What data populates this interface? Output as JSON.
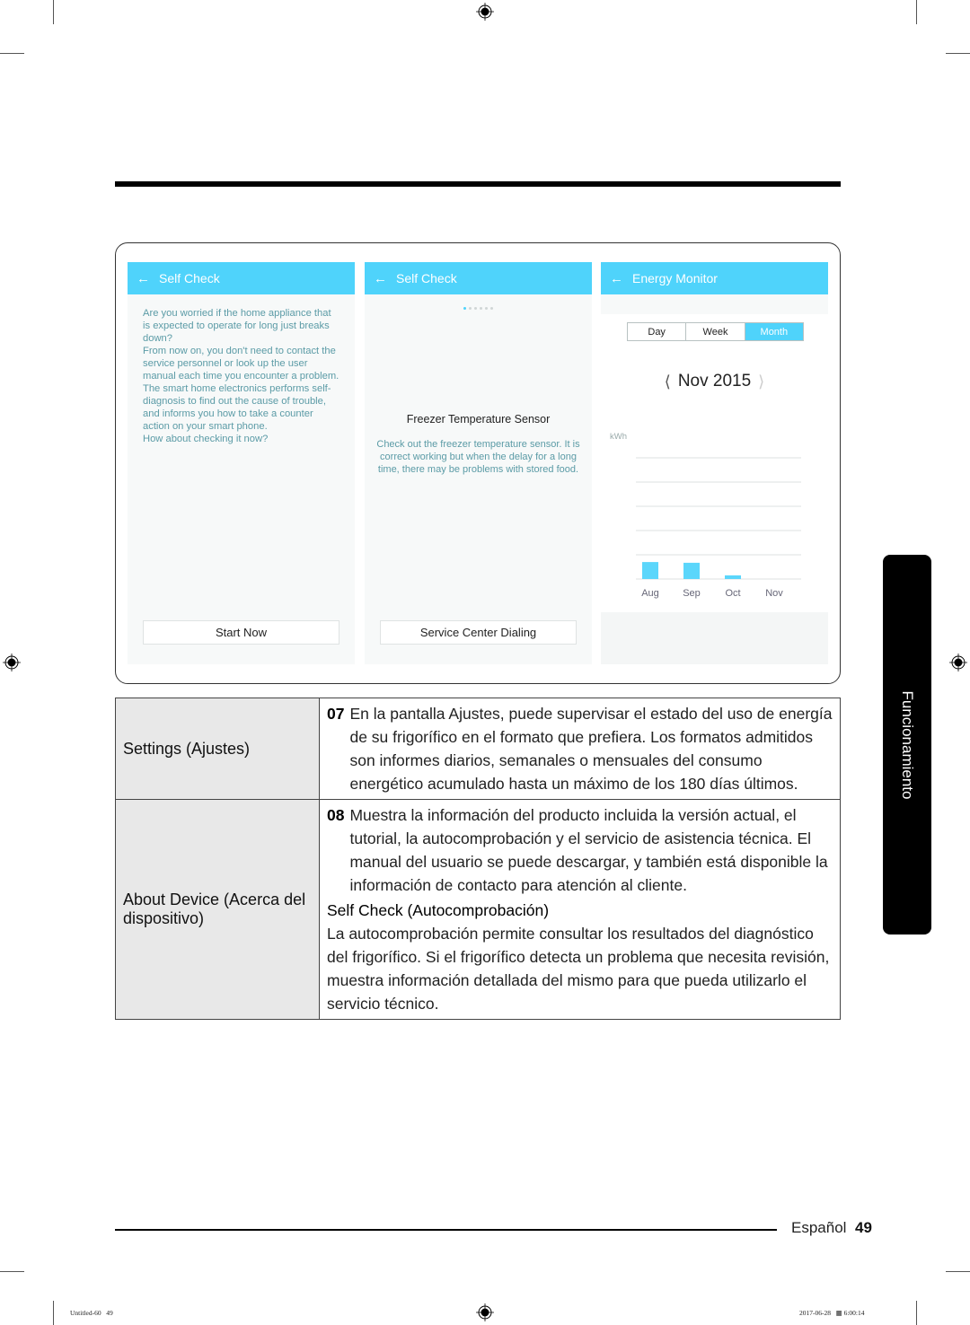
{
  "screens": [
    {
      "header": {
        "back_icon": "arrow-left-icon",
        "title": "Self Check"
      },
      "body_text": "Are you worried if the home appliance that is expected to operate for long just breaks down?\nFrom now on, you don't need to contact the service personnel or look up the user manual each time you encounter a problem.\nThe smart home electronics performs self-diagnosis to find out the cause of trouble, and informs you how to take a counter action on your smart phone.\nHow about checking it now?",
      "button_label": "Start Now"
    },
    {
      "header": {
        "back_icon": "arrow-left-icon",
        "title": "Self Check"
      },
      "page_indicator": {
        "total": 6,
        "current": 1
      },
      "item_title": "Freezer Temperature Sensor",
      "item_description": "Check out the freezer temperature sensor. It is correct working but when the delay for a long time, there may be problems with stored food.",
      "button_label": "Service Center Dialing"
    },
    {
      "header": {
        "back_icon": "arrow-left-icon",
        "title": "Energy Monitor"
      },
      "period_tabs": [
        {
          "label": "Day",
          "active": false
        },
        {
          "label": "Week",
          "active": false
        },
        {
          "label": "Month",
          "active": true
        }
      ],
      "month_label": "Nov 2015",
      "prev_icon": "chevron-left-icon",
      "next_icon": "chevron-right-icon",
      "unit_label": "kWh"
    }
  ],
  "chart_data": {
    "type": "bar",
    "title": "",
    "xlabel": "",
    "ylabel": "kWh",
    "categories": [
      "Aug",
      "Sep",
      "Oct",
      "Nov"
    ],
    "values": [
      0.7,
      0.67,
      0.15,
      0
    ],
    "ylim": [
      0,
      5
    ],
    "grid": true,
    "gridlines": 5,
    "bar_color": "#5bd6fb"
  },
  "table": {
    "rows": [
      {
        "label": "Settings (Ajustes)",
        "number": "07",
        "text": "En la pantalla Ajustes, puede supervisar el estado del uso de energía de su frigorífico en el formato que prefiera. Los formatos admitidos son informes diarios, semanales o mensuales del consumo energético acumulado hasta un máximo de los 180 días últimos."
      },
      {
        "label": "About Device (Acerca del dispositivo)",
        "number": "08",
        "text": "Muestra la información del producto incluida la versión actual, el tutorial, la autocomprobación y el servicio de asistencia técnica. El manual del usuario se puede descargar, y también está disponible la información de contacto para atención al cliente.",
        "subheading": "Self Check (Autocomprobación)",
        "subtext": "La autocomprobación permite consultar los resultados del diagnóstico del frigorífico. Si el frigorífico detecta un problema que necesita revisión, muestra información detallada del mismo para que pueda utilizarlo el servicio técnico."
      }
    ]
  },
  "side_tab": "Funcionamiento",
  "footer": {
    "language": "Español",
    "page_number": "49"
  },
  "slug": {
    "left": "Untitled-60   49",
    "right": "2017-06-28   ▦ 6:00:14"
  },
  "colors": {
    "accent": "#4fd3fb",
    "muted_text": "#5b9ba6",
    "label_bg": "#e8e8e8"
  }
}
